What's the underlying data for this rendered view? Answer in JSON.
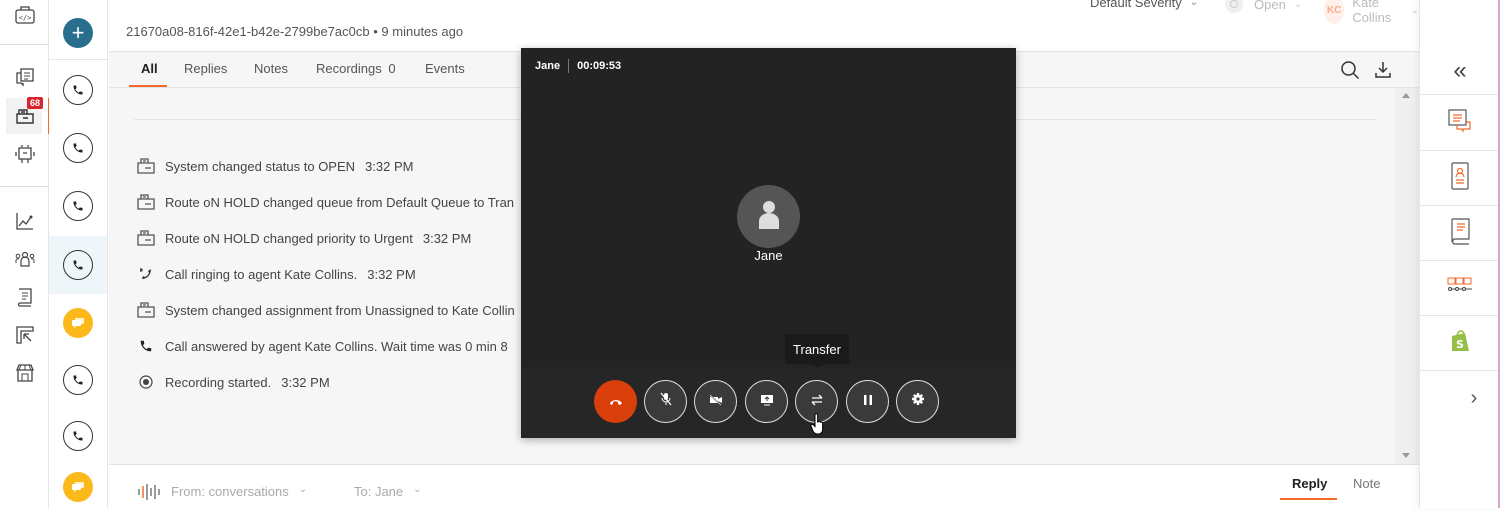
{
  "nav": {
    "badge_count": "68",
    "items": [
      "developer-icon",
      "conversations-icon",
      "inbox-icon",
      "bot-icon",
      "analytics-icon",
      "contacts-icon",
      "knowledge-icon",
      "reports-icon",
      "store-icon"
    ]
  },
  "conversation_list": {
    "new_label": "+",
    "items": [
      {
        "type": "call"
      },
      {
        "type": "call"
      },
      {
        "type": "call"
      },
      {
        "type": "call",
        "selected": true
      },
      {
        "type": "chat"
      },
      {
        "type": "call"
      },
      {
        "type": "call"
      },
      {
        "type": "chat"
      }
    ]
  },
  "header": {
    "conversation_id": "21670a08-816f-42e1-b42e-2799be7ac0cb",
    "separator": "•",
    "time_ago": "9 minutes ago",
    "severity": "Default Severity",
    "status": "Open",
    "assignee_initials": "KC",
    "assignee": "Kate Collins"
  },
  "tabs": [
    {
      "label": "All",
      "active": true
    },
    {
      "label": "Replies"
    },
    {
      "label": "Notes"
    },
    {
      "label": "Recordings",
      "count": "0"
    },
    {
      "label": "Events"
    }
  ],
  "events": [
    {
      "icon": "system",
      "text": "System changed status to OPEN",
      "time": "3:32 PM"
    },
    {
      "icon": "system",
      "text": "Route oN HOLD changed queue from Default Queue to Tran",
      "time": ""
    },
    {
      "icon": "system",
      "text": "Route oN HOLD changed priority to Urgent",
      "time": "3:32 PM"
    },
    {
      "icon": "ringing",
      "text": "Call ringing to agent Kate Collins.",
      "time": "3:32 PM"
    },
    {
      "icon": "system",
      "text": "System changed assignment from Unassigned to Kate Collin",
      "time": ""
    },
    {
      "icon": "phone",
      "text": "Call answered by agent Kate Collins. Wait time was 0 min 8",
      "time": ""
    },
    {
      "icon": "record",
      "text": "Recording started.",
      "time": "3:32 PM"
    }
  ],
  "footer": {
    "from": "From: conversations",
    "to": "To: Jane",
    "reply_tab": "Reply",
    "note_tab": "Note"
  },
  "call": {
    "name": "Jane",
    "duration": "00:09:53",
    "callee_name": "Jane",
    "tooltip": "Transfer",
    "controls": [
      "end-call",
      "mute",
      "video-off",
      "share-screen",
      "transfer",
      "hold",
      "settings"
    ],
    "end_color": "#d93f0b"
  },
  "colors": {
    "accent": "#f26a2b",
    "badge": "#d9262e",
    "new_button": "#2a6e8e",
    "chat": "#fbb91c"
  }
}
